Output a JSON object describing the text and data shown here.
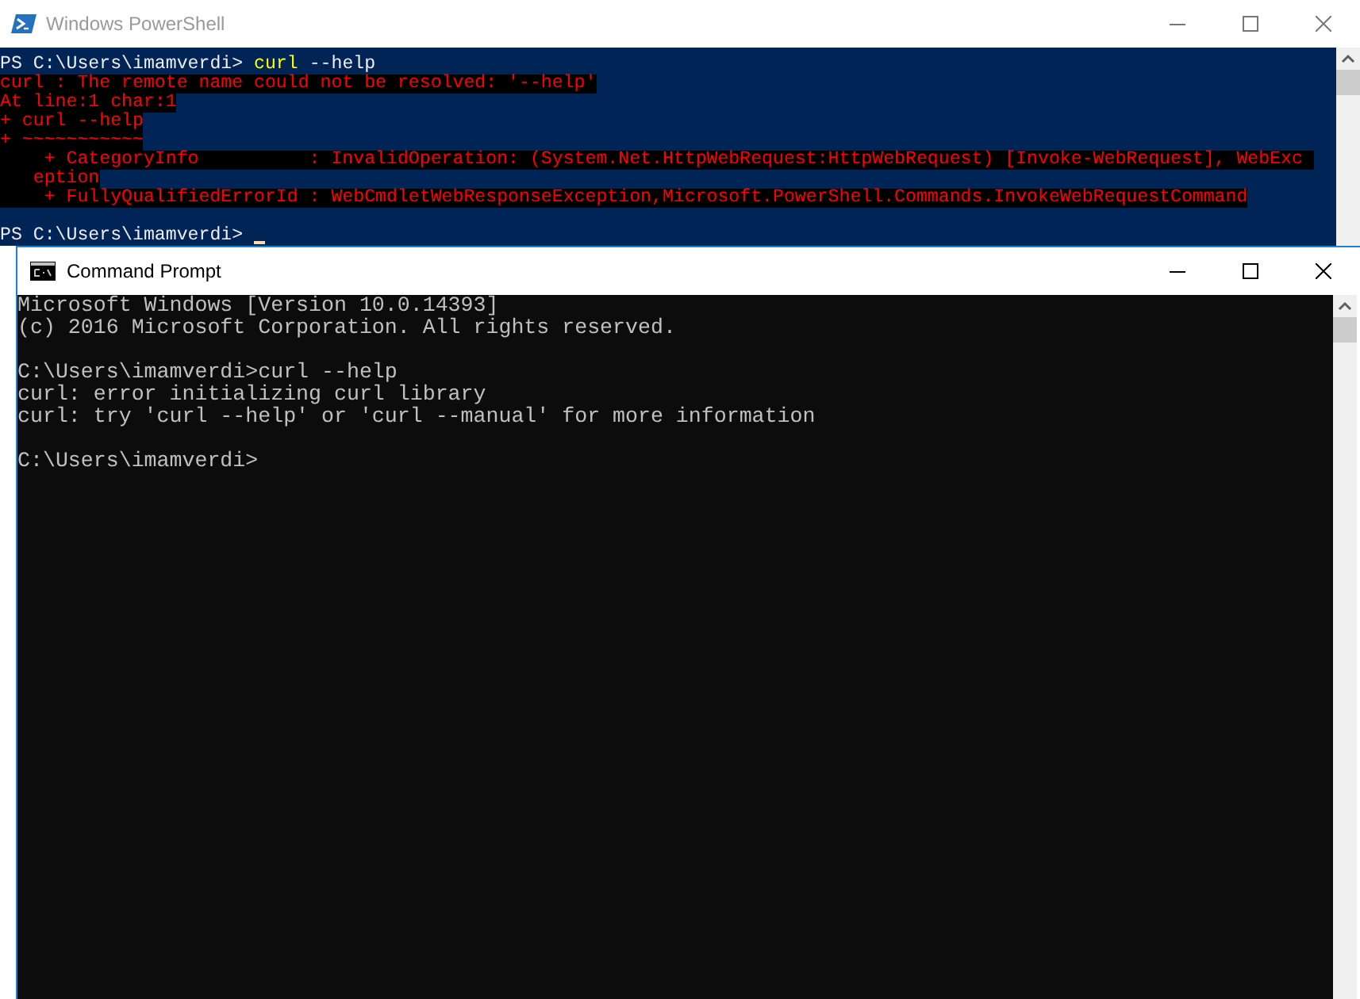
{
  "powershell": {
    "title": "Windows PowerShell",
    "active": false,
    "lines": [
      {
        "kind": "command",
        "prompt": "PS C:\\Users\\imamverdi> ",
        "command": "curl",
        "args": " --help"
      },
      {
        "kind": "error",
        "text": "curl : The remote name could not be resolved: '--help'"
      },
      {
        "kind": "error",
        "text": "At line:1 char:1"
      },
      {
        "kind": "error",
        "text": "+ curl --help"
      },
      {
        "kind": "error",
        "text": "+ ~~~~~~~~~~~"
      },
      {
        "kind": "error",
        "text": "    + CategoryInfo          : InvalidOperation: (System.Net.HttpWebRequest:HttpWebRequest) [Invoke-WebRequest], WebExc "
      },
      {
        "kind": "error",
        "text": "   eption"
      },
      {
        "kind": "error",
        "text": "    + FullyQualifiedErrorId : WebCmdletWebResponseException,Microsoft.PowerShell.Commands.InvokeWebRequestCommand"
      },
      {
        "kind": "prompt",
        "prompt": "PS C:\\Users\\imamverdi> ",
        "spacer_before": true,
        "cursor": true
      }
    ]
  },
  "command_prompt": {
    "title": "Command Prompt",
    "active": true,
    "lines": [
      {
        "kind": "output",
        "text": "Microsoft Windows [Version 10.0.14393]"
      },
      {
        "kind": "output",
        "text": "(c) 2016 Microsoft Corporation. All rights reserved."
      },
      {
        "kind": "output",
        "text": "C:\\Users\\imamverdi>curl --help",
        "spacer_before": true
      },
      {
        "kind": "output",
        "text": "curl: error initializing curl library"
      },
      {
        "kind": "output",
        "text": "curl: try 'curl --help' or 'curl --manual' for more information"
      },
      {
        "kind": "output",
        "text": "C:\\Users\\imamverdi>",
        "spacer_before": true
      }
    ]
  }
}
